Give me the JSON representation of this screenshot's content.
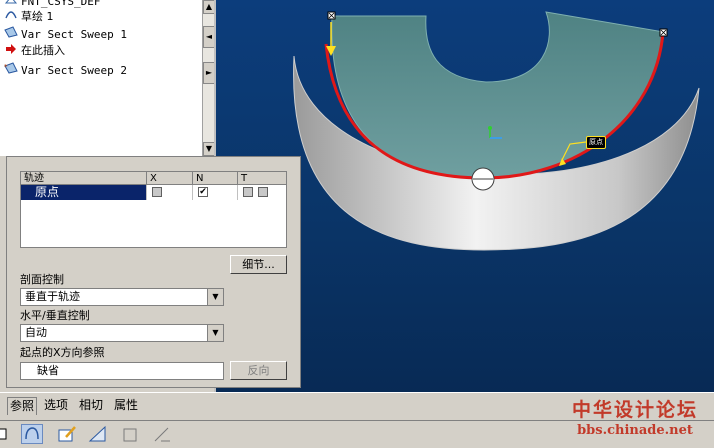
{
  "tree": {
    "items": [
      {
        "icon": "datum-plane-icon",
        "label": "FNT_CSYS_DEF"
      },
      {
        "icon": "sketch-icon",
        "label": "草绘 1"
      },
      {
        "icon": "sweep-feature-icon",
        "label": "Var Sect Sweep 1"
      },
      {
        "icon": "insert-here-arrow-icon",
        "label": "在此插入"
      },
      {
        "icon": "sweep-feature-active-icon",
        "label": "Var Sect Sweep 2"
      }
    ]
  },
  "references_panel": {
    "table": {
      "headers": [
        "轨迹",
        "X",
        "N",
        "T"
      ],
      "rows": [
        {
          "trajectory": "原点",
          "x_checked": false,
          "n_checked": true,
          "t_checked": false
        }
      ]
    },
    "details_button": "细节...",
    "section_control_label": "剖面控制",
    "section_control_value": "垂直于轨迹",
    "hv_control_label": "水平/垂直控制",
    "hv_control_value": "自动",
    "x_ref_label": "起点的X方向参照",
    "x_ref_value": "缺省",
    "flip_button": "反向"
  },
  "tabs": [
    "参照",
    "选项",
    "相切",
    "属性"
  ],
  "viewport": {
    "origin_tag": "原点",
    "colors": {
      "background": "#0a3568",
      "trajectory": "#e01818",
      "surface_top": "#5a8b8c"
    }
  },
  "watermark": {
    "title": "中华设计论坛",
    "url": "bbs.chinade.net"
  }
}
